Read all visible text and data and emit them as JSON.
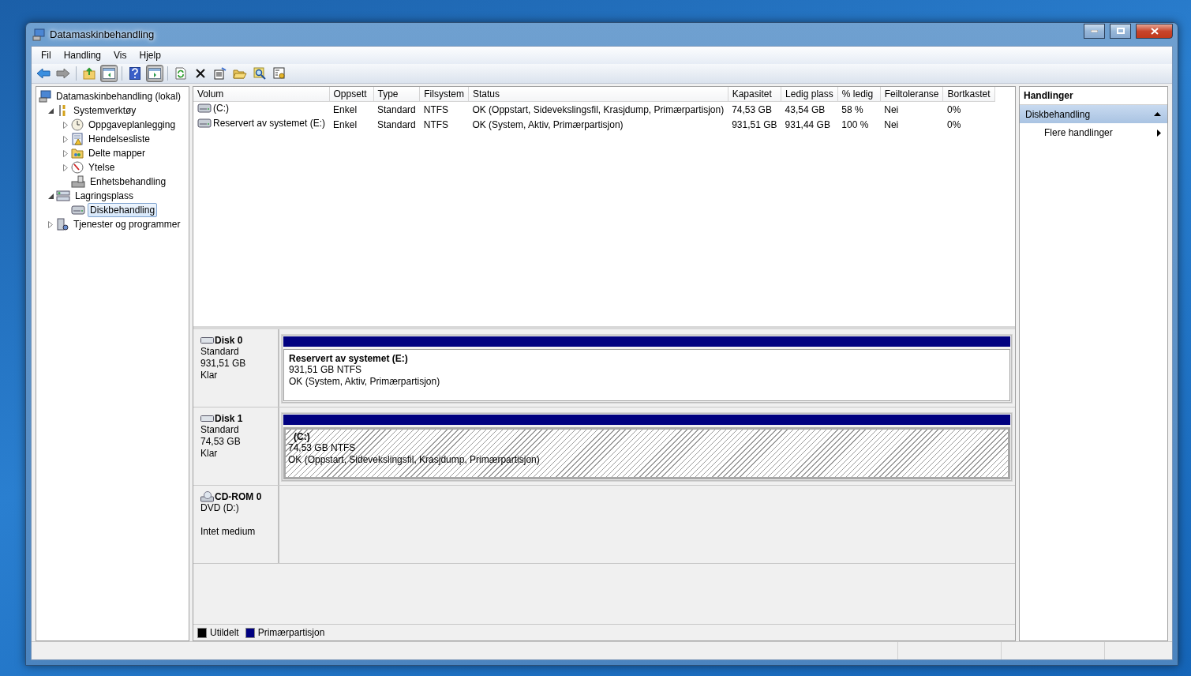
{
  "window": {
    "title": "Datamaskinbehandling"
  },
  "menu": [
    "Fil",
    "Handling",
    "Vis",
    "Hjelp"
  ],
  "toolbar": [
    [
      {
        "kind": "back",
        "pressed": false
      },
      {
        "kind": "forward",
        "pressed": false
      }
    ],
    [
      {
        "kind": "up",
        "pressed": false
      },
      {
        "kind": "pane-left",
        "pressed": true
      }
    ],
    [
      {
        "kind": "help",
        "pressed": false
      },
      {
        "kind": "pane-right",
        "pressed": true
      }
    ],
    [
      {
        "kind": "refresh",
        "pressed": false
      },
      {
        "kind": "delete",
        "pressed": false
      },
      {
        "kind": "properties",
        "pressed": false
      },
      {
        "kind": "open",
        "pressed": false
      },
      {
        "kind": "find",
        "pressed": false
      },
      {
        "kind": "settings",
        "pressed": false
      }
    ]
  ],
  "tree": [
    {
      "label": "Datamaskinbehandling (lokal)",
      "kind": "computer",
      "selected": false,
      "children": [
        {
          "label": "Systemverktøy",
          "kind": "tools",
          "expanded": true,
          "selected": false,
          "children": [
            {
              "label": "Oppgaveplanlegging",
              "kind": "clock",
              "expanded": false,
              "selected": false
            },
            {
              "label": "Hendelsesliste",
              "kind": "log",
              "expanded": false,
              "selected": false
            },
            {
              "label": "Delte mapper",
              "kind": "folder",
              "expanded": false,
              "selected": false
            },
            {
              "label": "Ytelse",
              "kind": "gauge",
              "expanded": false,
              "selected": false
            },
            {
              "label": "Enhetsbehandling",
              "kind": "device",
              "selected": false
            }
          ]
        },
        {
          "label": "Lagringsplass",
          "kind": "storage",
          "expanded": true,
          "selected": false,
          "children": [
            {
              "label": "Diskbehandling",
              "kind": "disk",
              "selected": true
            }
          ]
        },
        {
          "label": "Tjenester og programmer",
          "kind": "services",
          "expanded": false,
          "selected": false
        }
      ]
    }
  ],
  "table": {
    "columns": [
      "Volum",
      "Oppsett",
      "Type",
      "Filsystem",
      "Status",
      "Kapasitet",
      "Ledig plass",
      "% ledig",
      "Feiltoleranse",
      "Bortkastet"
    ],
    "rows": [
      {
        "cells": [
          "(C:)",
          "Enkel",
          "Standard",
          "NTFS",
          "OK (Oppstart, Sidevekslingsfil, Krasjdump, Primærpartisjon)",
          "74,53 GB",
          "43,54 GB",
          "58 %",
          "Nei",
          "0%"
        ]
      },
      {
        "cells": [
          "Reservert av systemet (E:)",
          "Enkel",
          "Standard",
          "NTFS",
          "OK (System, Aktiv, Primærpartisjon)",
          "931,51 GB",
          "931,44 GB",
          "100 %",
          "Nei",
          "0%"
        ]
      }
    ]
  },
  "disks": [
    {
      "kind": "disk",
      "name": "Disk 0",
      "lines": [
        "Standard",
        "931,51 GB",
        "Klar"
      ],
      "partitions": [
        {
          "title": "Reservert av systemet  (E:)",
          "size": "931,51 GB NTFS",
          "status": "OK (System, Aktiv, Primærpartisjon)",
          "selected": false
        }
      ]
    },
    {
      "kind": "disk",
      "name": "Disk 1",
      "lines": [
        "Standard",
        "74,53 GB",
        "Klar"
      ],
      "partitions": [
        {
          "title": "(C:)",
          "size": "74,53 GB NTFS",
          "status": "OK (Oppstart, Sidevekslingsfil, Krasjdump, Primærpartisjon)",
          "selected": true
        }
      ]
    },
    {
      "kind": "cdrom",
      "name": "CD-ROM 0",
      "lines": [
        "DVD (D:)",
        "Intet medium"
      ]
    }
  ],
  "legend": [
    {
      "label": "Utildelt",
      "color": "#000000"
    },
    {
      "label": "Primærpartisjon",
      "color": "#000080"
    }
  ],
  "actions": {
    "title": "Handlinger",
    "sections": [
      {
        "label": "Diskbehandling",
        "expanded": true,
        "items": [
          "Flere handlinger"
        ]
      }
    ]
  }
}
